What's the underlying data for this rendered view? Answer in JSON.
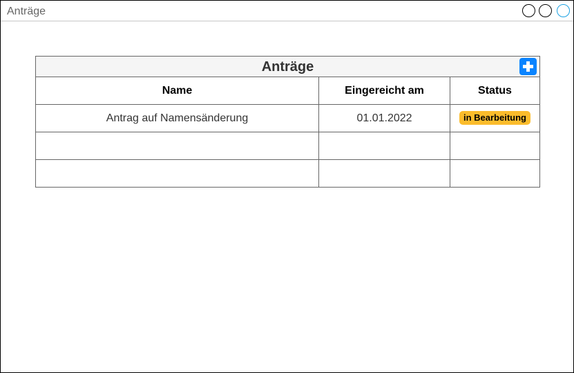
{
  "window": {
    "title": "Anträge"
  },
  "panel": {
    "title": "Anträge",
    "add_icon": "plus-icon"
  },
  "table": {
    "columns": [
      "Name",
      "Eingereicht am",
      "Status"
    ],
    "rows": [
      {
        "name": "Antrag auf Namensänderung",
        "submitted": "01.01.2022",
        "status": "in Bearbeitung"
      },
      {
        "name": "",
        "submitted": "",
        "status": ""
      },
      {
        "name": "",
        "submitted": "",
        "status": ""
      }
    ]
  },
  "colors": {
    "accent": "#0a84ff",
    "status_in_progress": "#fbbc2c",
    "border": "#666666",
    "header_bg": "#f5f5f5"
  }
}
